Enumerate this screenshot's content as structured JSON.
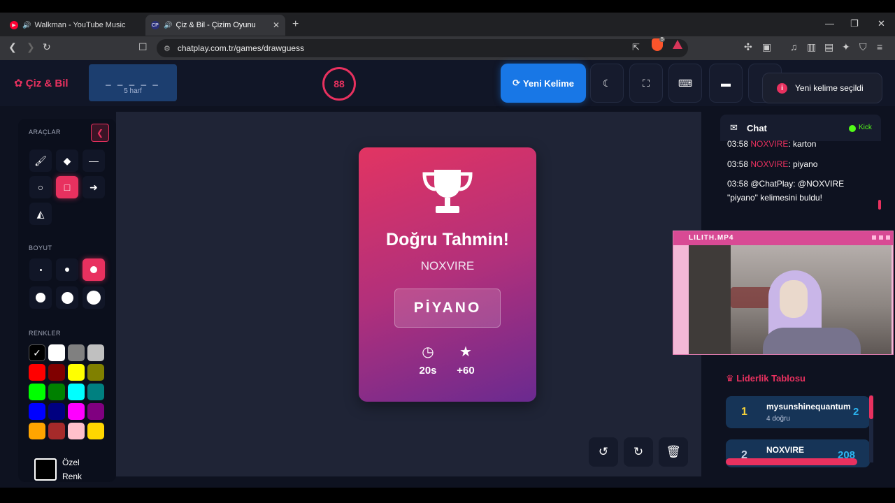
{
  "browser": {
    "tabs": [
      {
        "title": "Walkman - YouTube Music",
        "favicon": "youtube-music-icon",
        "color": "#ff0033"
      },
      {
        "title": "Çiz & Bil - Çizim Oyunu",
        "favicon_text": "CP",
        "color": "#5865f2"
      }
    ],
    "url": "chatplay.com.tr/games/drawguess",
    "brave_badge": "5"
  },
  "app": {
    "logo": "Çiz & Bil",
    "word": {
      "dashes": "_ _ _ _ _",
      "hint": "5 harf"
    },
    "timer": "88",
    "new_word_label": "Yeni Kelime",
    "toast": {
      "icon": "i",
      "text": "Yeni kelime seçildi"
    },
    "accent": "#e8315f"
  },
  "tools": {
    "section_tools": "ARAÇLAR",
    "section_size": "BOYUT",
    "section_colors": "RENKLER",
    "custom_color_label": "Özel Renk",
    "tool_list": [
      "brush",
      "eraser",
      "line",
      "circle",
      "rectangle",
      "arrow",
      "fill"
    ],
    "active_tool": "rectangle",
    "active_size_index": 2,
    "colors": [
      "#000000",
      "#ffffff",
      "#808080",
      "#c0c0c0",
      "#ff0000",
      "#800000",
      "#ffff00",
      "#808000",
      "#00ff00",
      "#008000",
      "#00ffff",
      "#008080",
      "#0000ff",
      "#000080",
      "#ff00ff",
      "#800080",
      "#ffa500",
      "#a52a2a",
      "#ffc0cb",
      "#ffd700"
    ]
  },
  "result_card": {
    "title": "Doğru Tahmin!",
    "player": "NOXVIRE",
    "word": "PİYANO",
    "time": "20s",
    "points": "+60"
  },
  "chat": {
    "title": "Chat",
    "platform": "Kick",
    "messages": [
      {
        "time": "03:58",
        "user": "NOXVIRE",
        "text": ": karton"
      },
      {
        "time": "03:58",
        "user": "NOXVIRE",
        "text": ": piyano"
      },
      {
        "time": "03:58",
        "user": "@ChatPlay",
        "text": ": @NOXVIRE \"piyano\" kelimesini buldu!"
      }
    ]
  },
  "webcam": {
    "title": "LILITH.MP4"
  },
  "leaderboard": {
    "title": "Liderlik Tablosu",
    "entries": [
      {
        "rank": "1",
        "name": "mysunshinequantum",
        "sub": "4 doğru",
        "score": "2"
      },
      {
        "rank": "2",
        "name": "NOXVIRE",
        "sub": "",
        "score": "208"
      }
    ]
  }
}
